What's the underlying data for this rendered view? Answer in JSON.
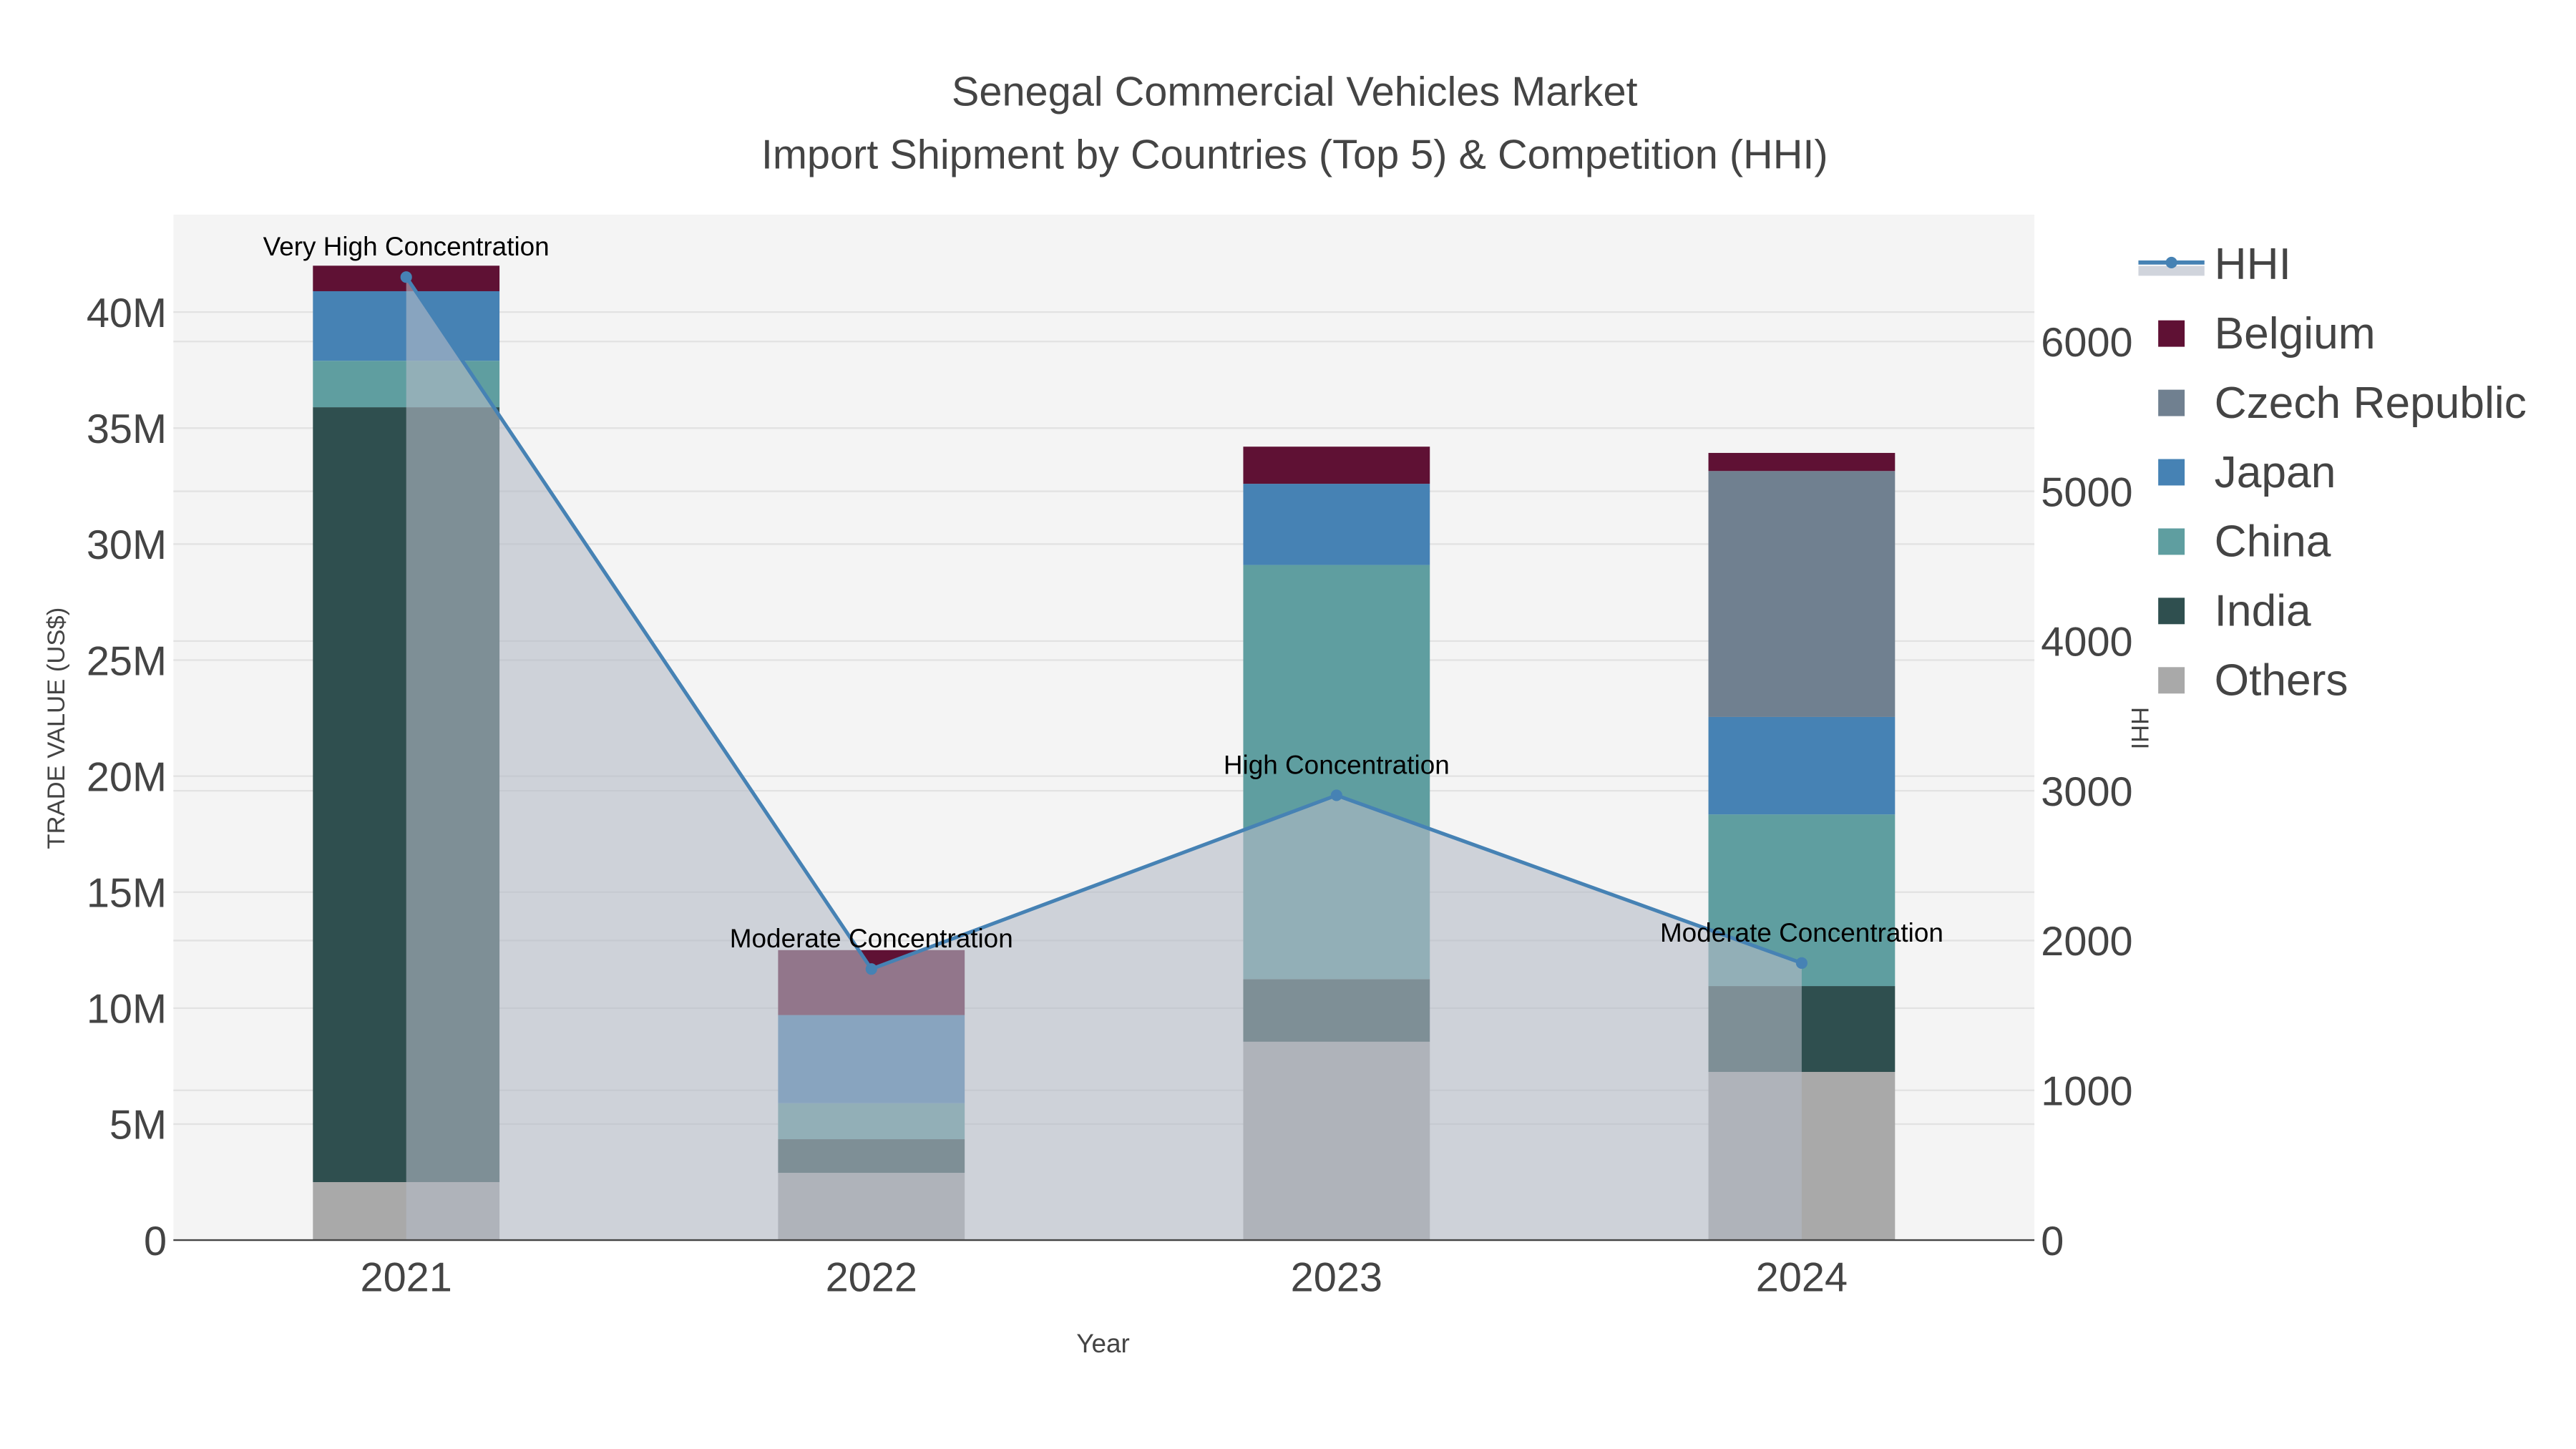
{
  "chart_data": {
    "type": "bar",
    "title": "Senegal Commercial Vehicles Market",
    "subtitle": "Import Shipment by Countries (Top 5) & Competition (HHI)",
    "xlabel": "Year",
    "ylabel": "TRADE VALUE (US$)",
    "y2label": "HHI",
    "categories": [
      "2021",
      "2022",
      "2023",
      "2024"
    ],
    "ylim": [
      0,
      44000000
    ],
    "y2lim": [
      0,
      6800
    ],
    "yticks": [
      0,
      5000000,
      10000000,
      15000000,
      20000000,
      25000000,
      30000000,
      35000000,
      40000000
    ],
    "ytick_labels": [
      "0",
      "5M",
      "10M",
      "15M",
      "20M",
      "25M",
      "30M",
      "35M",
      "40M"
    ],
    "y2ticks": [
      0,
      1000,
      2000,
      3000,
      4000,
      5000,
      6000
    ],
    "y2tick_labels": [
      "0",
      "1000",
      "2000",
      "3000",
      "4000",
      "5000",
      "6000"
    ],
    "grid": true,
    "legend_position": "right",
    "series": [
      {
        "name": "Others",
        "color": "#a9a9a9",
        "values": [
          2500000,
          2900000,
          8550000,
          7250000
        ]
      },
      {
        "name": "India",
        "color": "#2f4f4f",
        "values": [
          33400000,
          1450000,
          2700000,
          3700000
        ]
      },
      {
        "name": "China",
        "color": "#5f9ea0",
        "values": [
          2000000,
          1550000,
          17850000,
          7400000
        ]
      },
      {
        "name": "Japan",
        "color": "#4682b4",
        "values": [
          3000000,
          3800000,
          3500000,
          4200000
        ]
      },
      {
        "name": "Czech Republic",
        "color": "#708090",
        "values": [
          0,
          0,
          0,
          10600000
        ]
      },
      {
        "name": "Belgium",
        "color": "#5f1134",
        "values": [
          1100000,
          2800000,
          1600000,
          780000
        ]
      }
    ],
    "hhi": {
      "name": "HHI",
      "color": "#4682b4",
      "values": [
        6430,
        1810,
        2970,
        1850
      ],
      "annotations": [
        "Very High Concentration",
        "Moderate Concentration",
        "High Concentration",
        "Moderate Concentration"
      ]
    },
    "legend_order": [
      "HHI",
      "Belgium",
      "Czech Republic",
      "Japan",
      "China",
      "India",
      "Others"
    ]
  }
}
